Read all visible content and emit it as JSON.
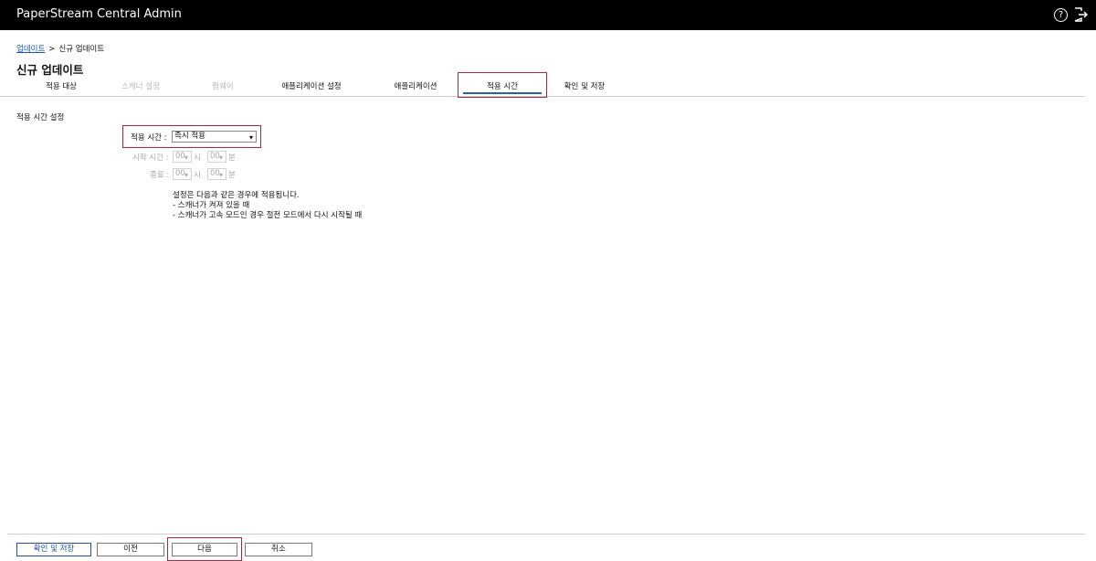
{
  "window": {
    "title": "PaperStream Central Admin",
    "help_icon": "help-icon",
    "logout_icon": "logout-icon"
  },
  "breadcrumb": {
    "parent": "업데이트",
    "separator": ">",
    "current": "신규 업데이트"
  },
  "page_title": "신규 업데이트",
  "tabs": [
    {
      "label": "적용 대상",
      "state": "enabled"
    },
    {
      "label": "스캐너 설정",
      "state": "disabled"
    },
    {
      "label": "펌웨어",
      "state": "disabled"
    },
    {
      "label": "애플리케이션 설정",
      "state": "enabled"
    },
    {
      "label": "애플리케이션",
      "state": "enabled"
    },
    {
      "label": "적용 시간",
      "state": "active"
    },
    {
      "label": "확인 및 저장",
      "state": "enabled"
    }
  ],
  "section_label": "적용 시간 설정",
  "apply_time": {
    "label": "적용 시간 :",
    "value": "즉시 적용"
  },
  "start_time": {
    "label": "시작 시간 :",
    "hour": "00",
    "hour_unit": "시",
    "minute": "00",
    "minute_unit": "분"
  },
  "end_time": {
    "label": "종료 :",
    "hour": "00",
    "hour_unit": "시",
    "minute": "00",
    "minute_unit": "분"
  },
  "info_lines": [
    "설정은 다음과 같은 경우에 적용됩니다.",
    "- 스캐너가 켜져 있을 때",
    "- 스캐너가 고속 모드인 경우 절전 모드에서 다시 시작될 때"
  ],
  "buttons": {
    "confirm_save": "확인 및 저장",
    "previous": "이전",
    "next": "다음",
    "cancel": "취소"
  },
  "colors": {
    "titlebar": "#000000",
    "highlight": "#b0253a",
    "active_tab_underline": "#2a62ad",
    "link": "#1a55b8"
  }
}
